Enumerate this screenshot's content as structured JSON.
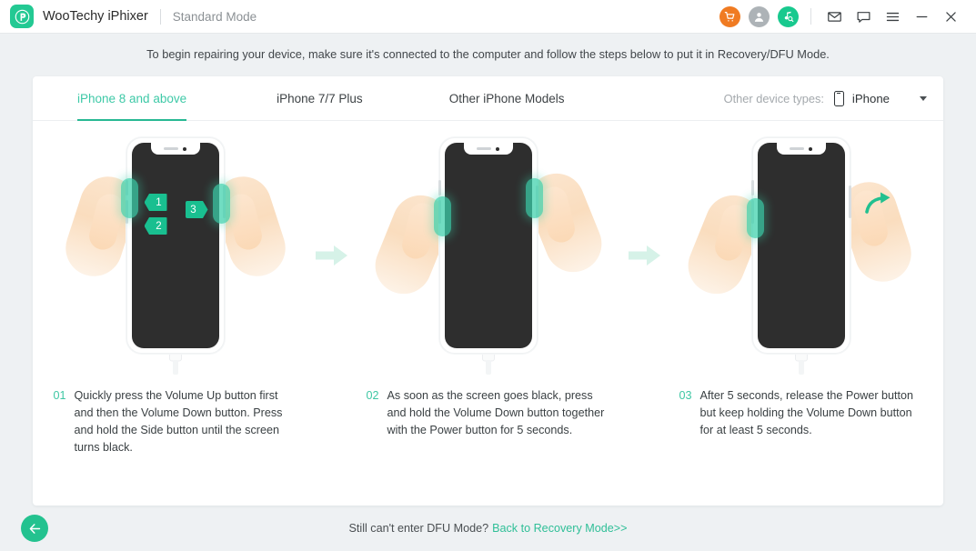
{
  "titlebar": {
    "brand": "WooTechy iPhixer",
    "mode": "Standard Mode",
    "icons": {
      "cart": "cart-icon",
      "account": "account-icon",
      "music_search": "music-search-icon",
      "mail": "mail-icon",
      "chat": "chat-icon",
      "menu": "hamburger-menu-icon",
      "minimize": "minimize-icon",
      "close": "close-icon"
    }
  },
  "subtitle": "To begin repairing your device, make sure it's connected to the computer and follow the steps below to put it in Recovery/DFU Mode.",
  "tabs": [
    {
      "label": "iPhone 8 and above",
      "active": true
    },
    {
      "label": "iPhone 7/7 Plus",
      "active": false
    },
    {
      "label": "Other iPhone Models",
      "active": false
    }
  ],
  "device_select": {
    "label": "Other device types:",
    "value": "iPhone",
    "icon": "phone-icon",
    "caret": "chevron-down-icon"
  },
  "steps": [
    {
      "num": "01",
      "text": "Quickly press the Volume Up button first and then the Volume Down button. Press and hold the Side button until the screen turns black.",
      "badges": [
        "1",
        "2",
        "3"
      ]
    },
    {
      "num": "02",
      "text": "As soon as the screen goes black, press and hold the Volume Down button together with the Power button for 5 seconds.",
      "badges": []
    },
    {
      "num": "03",
      "text": "After 5 seconds, release the Power button but keep holding the Volume Down button for at least 5 seconds.",
      "badges": []
    }
  ],
  "footer": {
    "back_icon": "back-arrow-icon",
    "question": "Still can't enter DFU Mode?",
    "link": "Back to Recovery Mode>>"
  },
  "colors": {
    "accent": "#23c993",
    "accent_tab": "#3ec9a7",
    "badge": "#19bf90",
    "highlight": "#3bd1ab",
    "cart": "#f07b22",
    "page_bg": "#eef1f3",
    "card_bg": "#ffffff",
    "screen": "#2e2e2e"
  }
}
